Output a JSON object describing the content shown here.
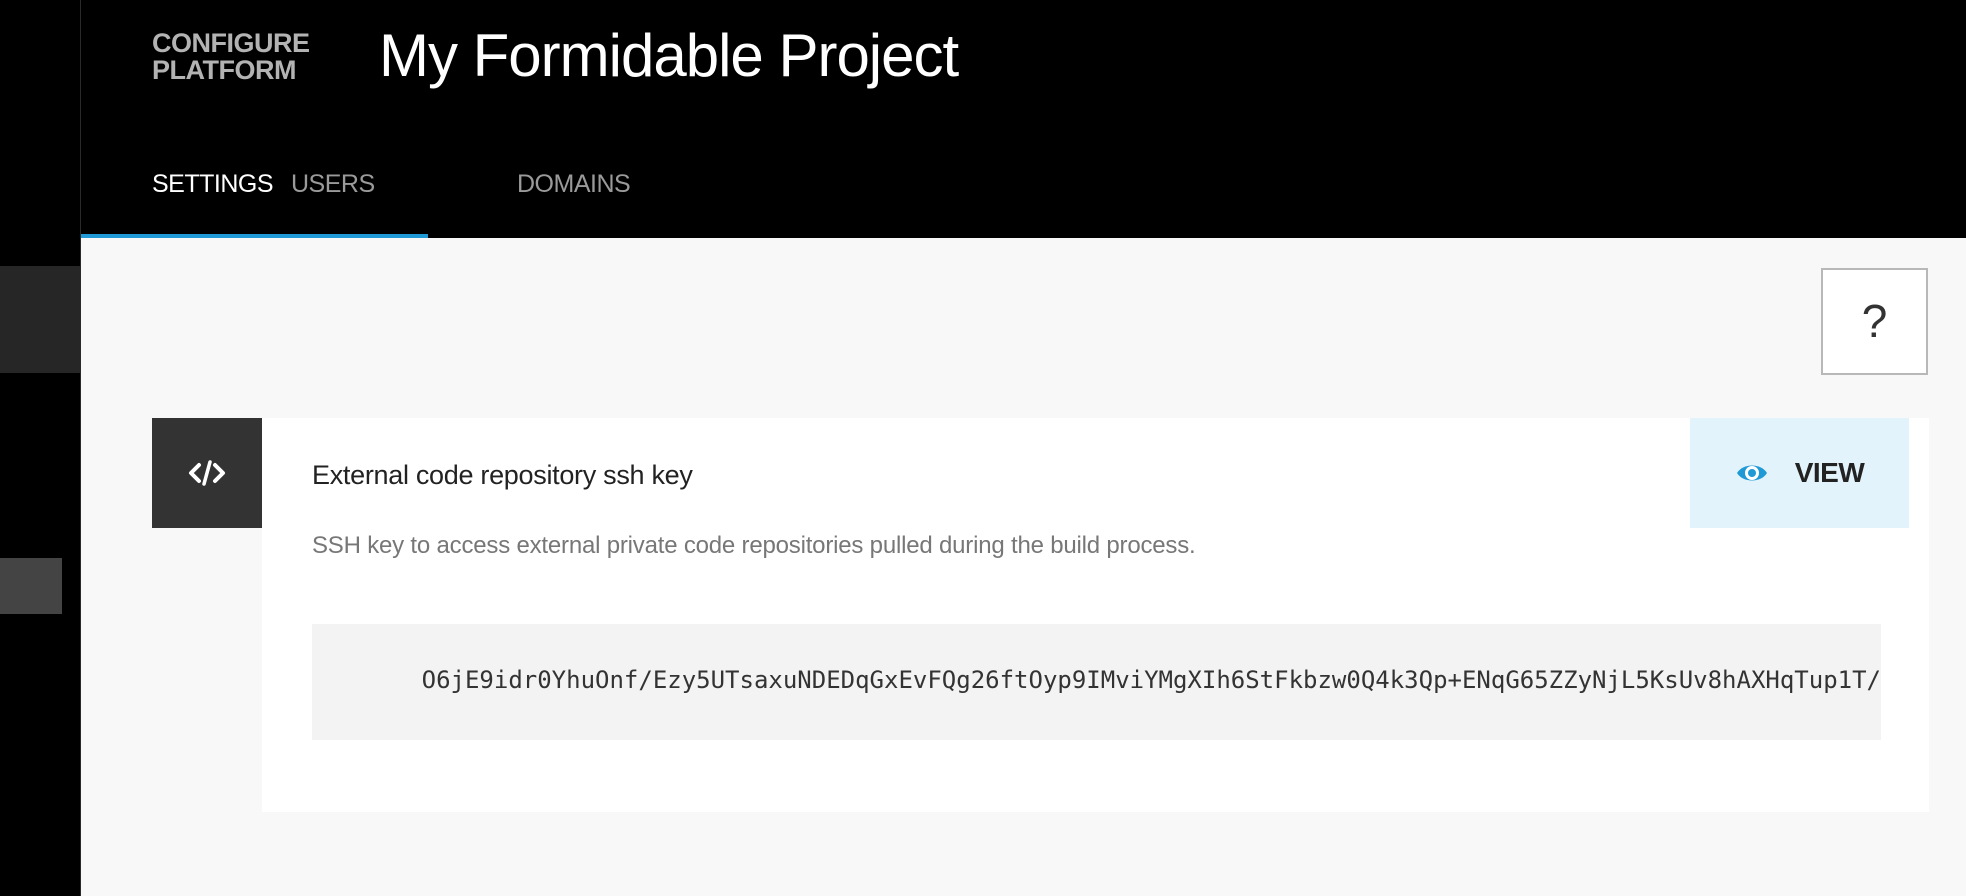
{
  "brand": {
    "line1": "CONFIGURE",
    "line2": "PLATFORM"
  },
  "project": {
    "title": "My Formidable Project"
  },
  "tabs": [
    {
      "label": "SETTINGS",
      "active": true
    },
    {
      "label": "USERS",
      "active": false
    },
    {
      "label": "DOMAINS",
      "active": false
    }
  ],
  "help": {
    "label": "?"
  },
  "card": {
    "icon": "code-icon",
    "title": "External code repository ssh key",
    "description": "SSH key to access external private code repositories pulled during the build process.",
    "view_label": "VIEW",
    "view_icon": "eye-icon",
    "key_visible_fragment": "O6jE9idr0YhuOnf/Ezy5UTsaxuNDEDqGxEvFQg26ftOyp9IMviYMgXIh6StFkbzw0Q4k3Qp+ENqG65ZZyNjL5KsUv8hAXHqTup1T/"
  },
  "colors": {
    "accent": "#1f9ad6",
    "header_bg": "#000000",
    "content_bg": "#f8f8f8",
    "view_bg": "#e3f3fb",
    "icon_tile_bg": "#333333"
  }
}
